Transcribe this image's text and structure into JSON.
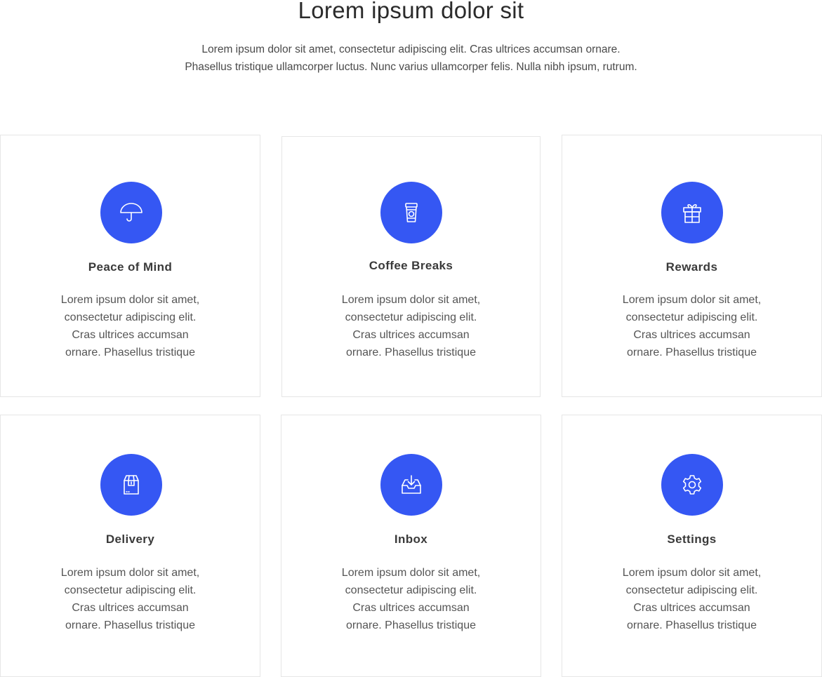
{
  "header": {
    "title": "Lorem ipsum dolor sit",
    "intro_line1": "Lorem ipsum dolor sit amet, consectetur adipiscing elit. Cras ultrices accumsan ornare.",
    "intro_line2": "Phasellus tristique ullamcorper luctus. Nunc varius ullamcorper felis. Nulla nibh ipsum, rutrum."
  },
  "colors": {
    "accent": "#3557f3",
    "border": "#e6e6e6"
  },
  "features": [
    {
      "title": "Peace of Mind",
      "icon": "umbrella-icon",
      "text": [
        "Lorem ipsum dolor sit amet,",
        "consectetur adipiscing elit.",
        "Cras ultrices accumsan",
        "ornare. Phasellus tristique"
      ]
    },
    {
      "title": "Coffee Breaks",
      "icon": "coffee-cup-icon",
      "text": [
        "Lorem ipsum dolor sit amet,",
        "consectetur adipiscing elit.",
        "Cras ultrices accumsan",
        "ornare. Phasellus tristique"
      ]
    },
    {
      "title": "Rewards",
      "icon": "gift-icon",
      "text": [
        "Lorem ipsum dolor sit amet,",
        "consectetur adipiscing elit.",
        "Cras ultrices accumsan",
        "ornare. Phasellus tristique"
      ]
    },
    {
      "title": "Delivery",
      "icon": "package-box-icon",
      "text": [
        "Lorem ipsum dolor sit amet,",
        "consectetur adipiscing elit.",
        "Cras ultrices accumsan",
        "ornare. Phasellus tristique"
      ]
    },
    {
      "title": "Inbox",
      "icon": "inbox-tray-icon",
      "text": [
        "Lorem ipsum dolor sit amet,",
        "consectetur adipiscing elit.",
        "Cras ultrices accumsan",
        "ornare. Phasellus tristique"
      ]
    },
    {
      "title": "Settings",
      "icon": "gear-icon",
      "text": [
        "Lorem ipsum dolor sit amet,",
        "consectetur adipiscing elit.",
        "Cras ultrices accumsan",
        "ornare. Phasellus tristique"
      ]
    }
  ]
}
